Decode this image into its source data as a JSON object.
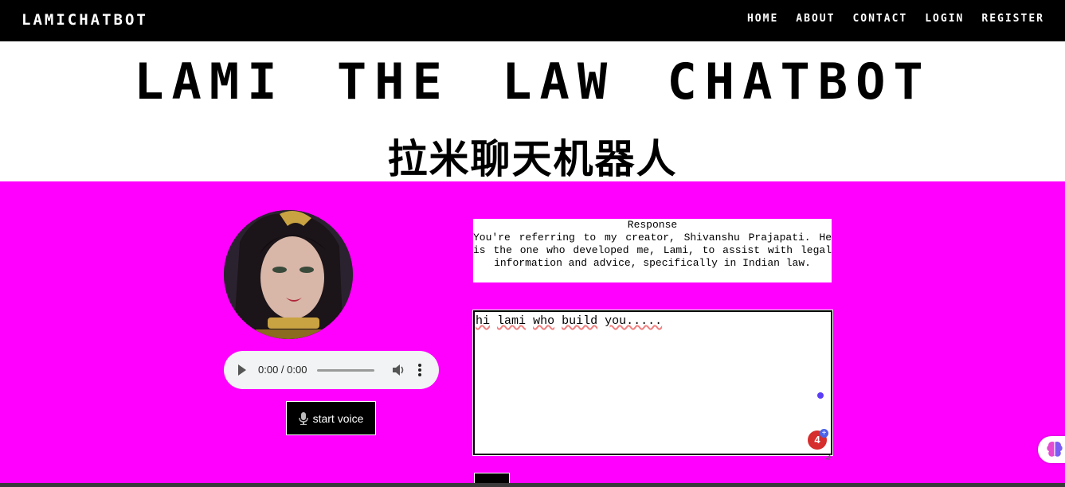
{
  "navbar": {
    "brand": "LAMICHATBOT",
    "links": [
      "HOME",
      "ABOUT",
      "CONTACT",
      "LOGIN",
      "REGISTER"
    ]
  },
  "header": {
    "title": "LAMI THE LAW CHATBOT",
    "subtitle": "拉米聊天机器人"
  },
  "audio": {
    "time": "0:00 / 0:00"
  },
  "voice_button": {
    "label": "start voice"
  },
  "response": {
    "title": "Response",
    "text": "You're referring to my creator, Shivanshu Prajapati. He is the one who developed me, Lami, to assist with legal information and advice, specifically in Indian law."
  },
  "chat_input": {
    "words": [
      "hi",
      "lami",
      "who",
      "build",
      "you....."
    ]
  },
  "grammar_badge": {
    "count": "4",
    "plus": "+"
  },
  "colors": {
    "background": "#ff00ff",
    "navbar": "#000000",
    "grammar": "#d62d2d"
  }
}
